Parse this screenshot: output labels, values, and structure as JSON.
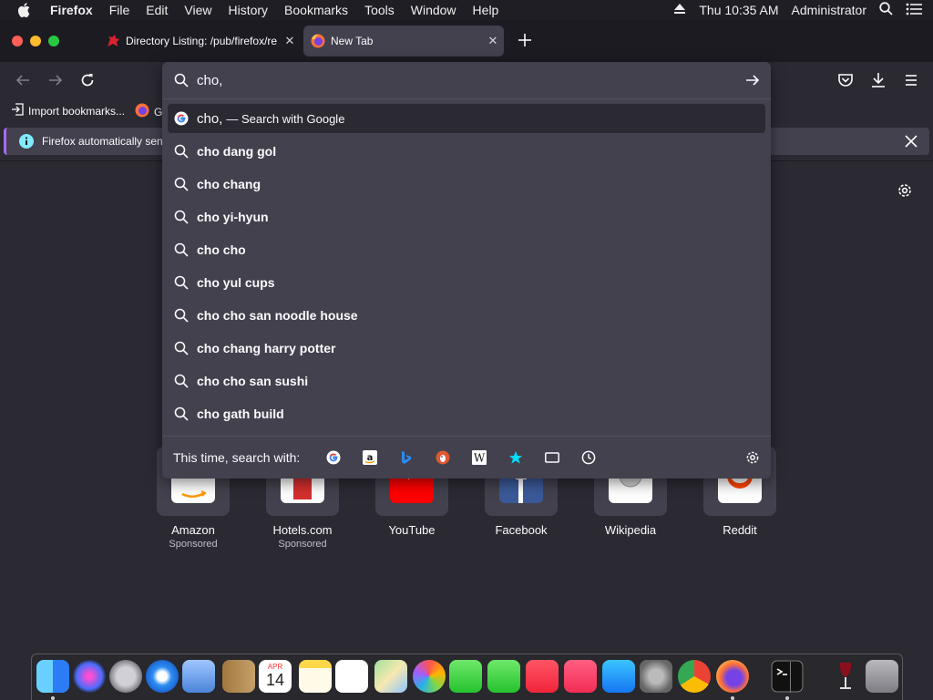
{
  "menubar": {
    "items": [
      "Firefox",
      "File",
      "Edit",
      "View",
      "History",
      "Bookmarks",
      "Tools",
      "Window",
      "Help"
    ],
    "clock": "Thu 10:35 AM",
    "user": "Administrator"
  },
  "tabs": {
    "inactive": {
      "title": "Directory Listing: /pub/firefox/re",
      "close": "✕"
    },
    "active": {
      "title": "New Tab",
      "close": "✕"
    },
    "new_tab_label": "+"
  },
  "bookmarks": {
    "import_label": "Import bookmarks...",
    "truncated_label": "G"
  },
  "notification": {
    "text": "Firefox automatically send"
  },
  "urlbar": {
    "value": "cho,",
    "first_suggestion_query": "cho,",
    "first_suggestion_action": "— Search with Google",
    "suggestions": [
      "cho dang gol",
      "cho chang",
      "cho yi-hyun",
      "cho cho",
      "cho yul cups",
      "cho cho san noodle house",
      "cho chang harry potter",
      "cho cho san sushi",
      "cho gath build"
    ],
    "one_off_label": "This time, search with:",
    "one_off_engines": [
      "google-icon",
      "amazon-icon",
      "bing-icon",
      "duckduckgo-icon",
      "wikipedia-icon",
      "bookmarks-star-icon",
      "tabs-icon",
      "history-clock-icon"
    ]
  },
  "top_sites": [
    {
      "name": "Amazon",
      "sub": "Sponsored"
    },
    {
      "name": "Hotels.com",
      "sub": "Sponsored"
    },
    {
      "name": "YouTube",
      "sub": ""
    },
    {
      "name": "Facebook",
      "sub": ""
    },
    {
      "name": "Wikipedia",
      "sub": ""
    },
    {
      "name": "Reddit",
      "sub": ""
    }
  ],
  "dock_apps": [
    "finder",
    "siri",
    "launchpad",
    "safari",
    "mail",
    "contacts",
    "calendar",
    "notes",
    "reminders",
    "maps",
    "photos",
    "messages",
    "facetime",
    "news",
    "music",
    "app-store",
    "system-preferences",
    "chrome",
    "firefox",
    "terminal",
    "wine",
    "trash"
  ],
  "dock_calendar": {
    "month": "APR",
    "day": "14"
  },
  "colors": {
    "menubar_bg": "#1f1e24",
    "tabstrip_bg": "#1c1b22",
    "page_bg": "#2b2a33",
    "panel_bg": "#42414d",
    "accent_purple": "#a86cff",
    "info_blue": "#80ebff"
  }
}
